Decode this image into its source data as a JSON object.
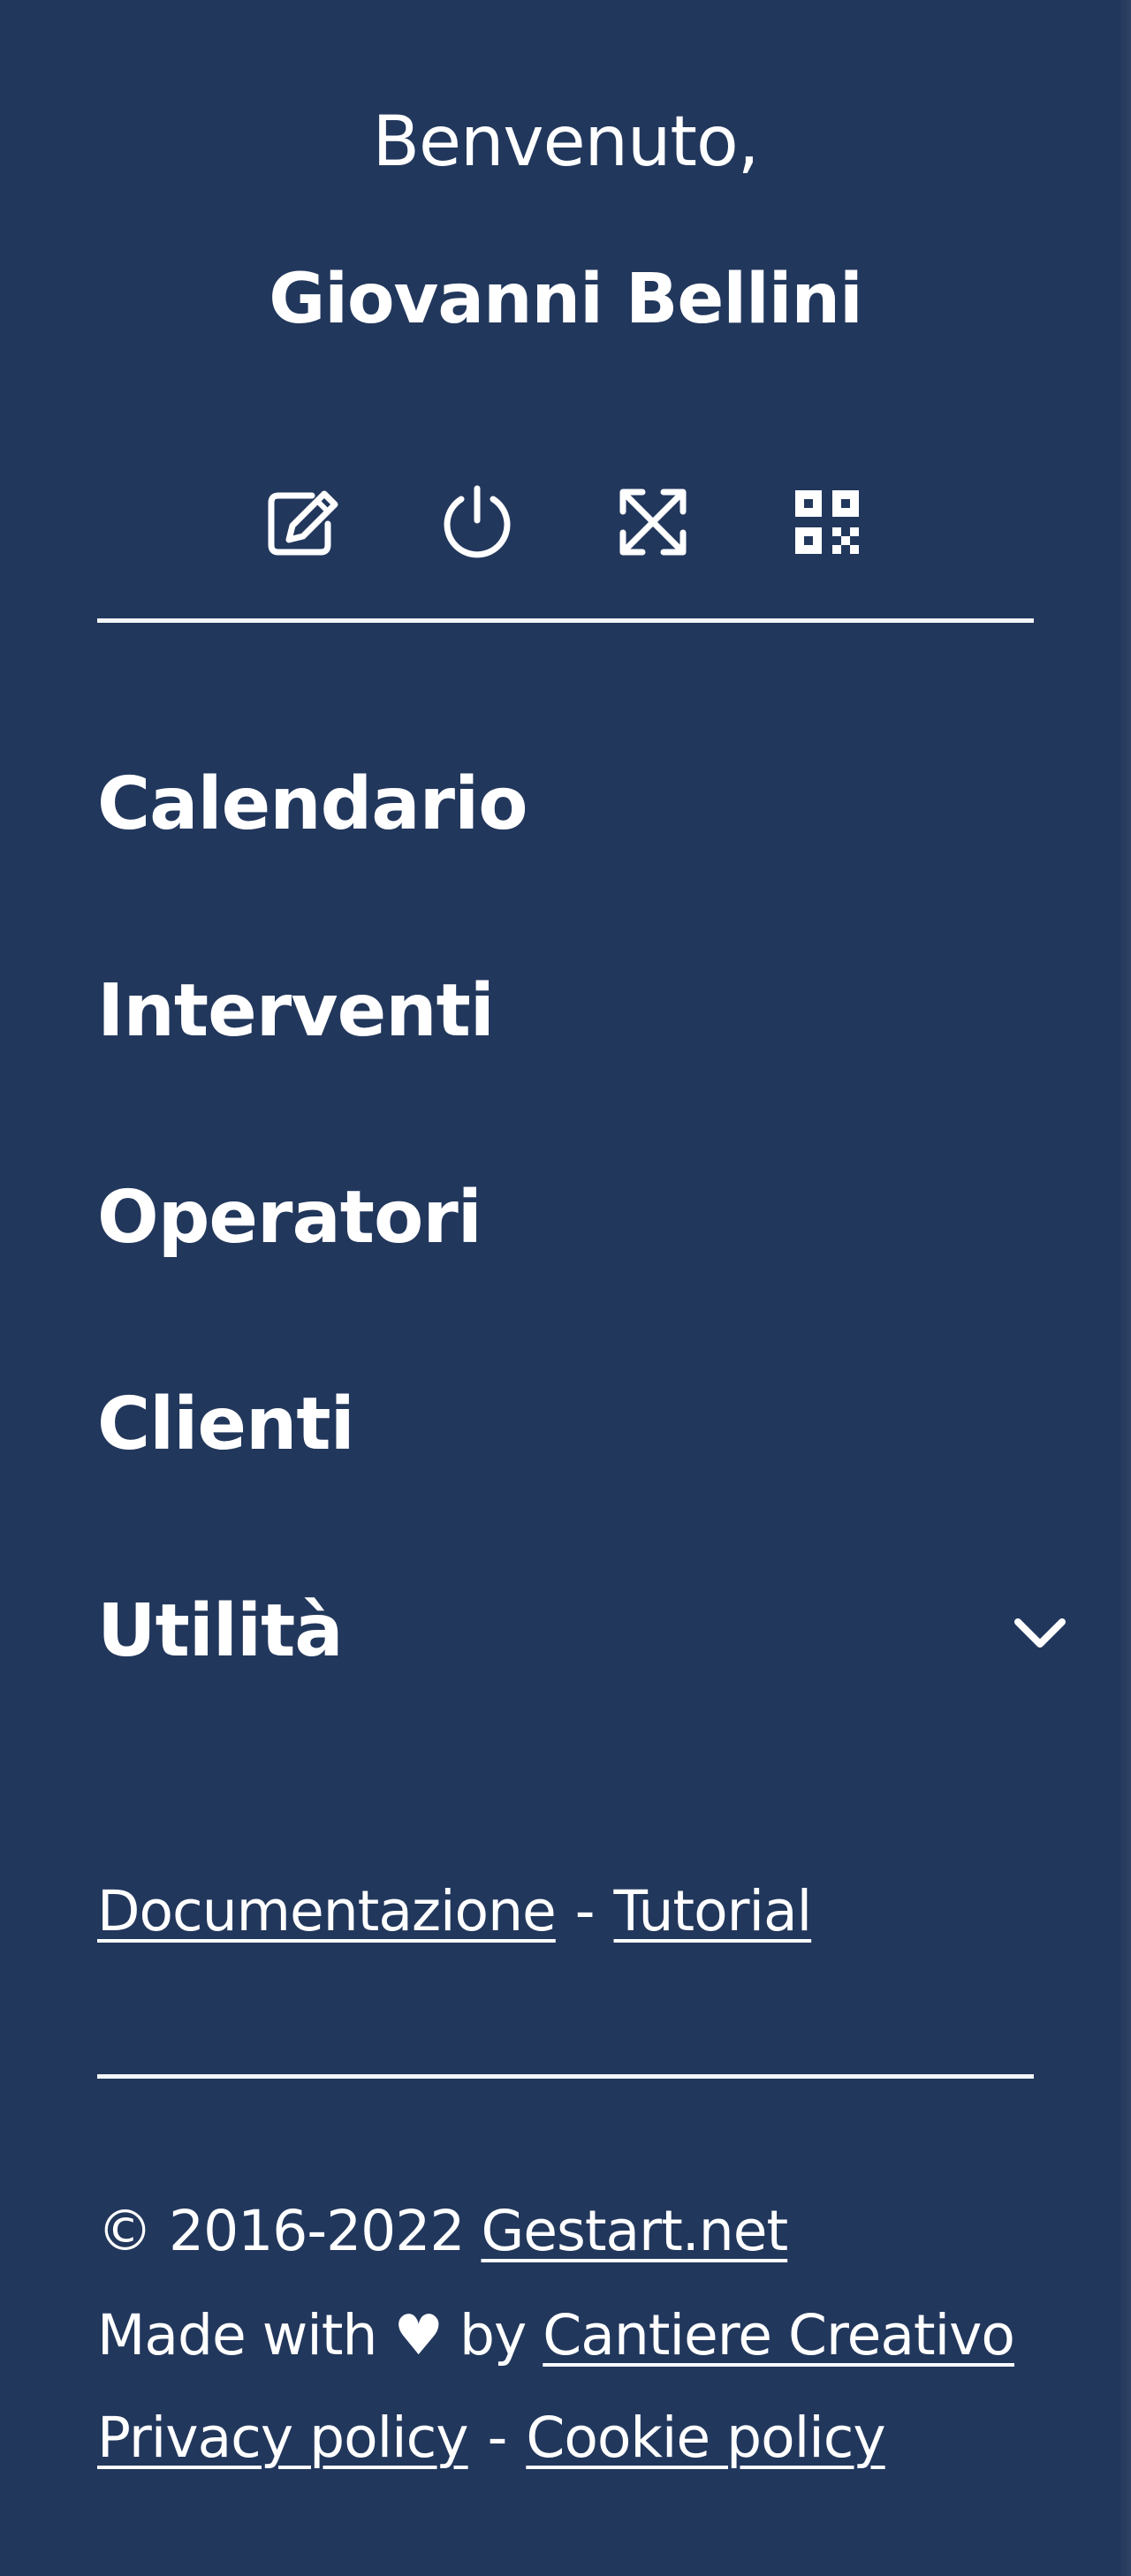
{
  "welcome": {
    "greeting": "Benvenuto,",
    "user_name": "Giovanni Bellini"
  },
  "toolbar": {
    "icons": [
      "edit-icon",
      "power-icon",
      "fullscreen-icon",
      "qr-code-icon"
    ]
  },
  "nav": {
    "items": [
      {
        "label": "Calendario"
      },
      {
        "label": "Interventi"
      },
      {
        "label": "Operatori"
      },
      {
        "label": "Clienti"
      },
      {
        "label": "Utilità",
        "has_submenu": true
      }
    ]
  },
  "links": {
    "documentation": "Documentazione",
    "separator": "-",
    "tutorial": "Tutorial"
  },
  "footer": {
    "copyright": "© 2016-2022",
    "site_link": "Gestart.net",
    "made_with": "Made with",
    "heart": "♥",
    "by": "by",
    "author_link": "Cantiere Creativo",
    "privacy": "Privacy policy",
    "separator": "-",
    "cookie": "Cookie policy"
  },
  "colors": {
    "background": "#22375c",
    "text": "#ffffff"
  }
}
